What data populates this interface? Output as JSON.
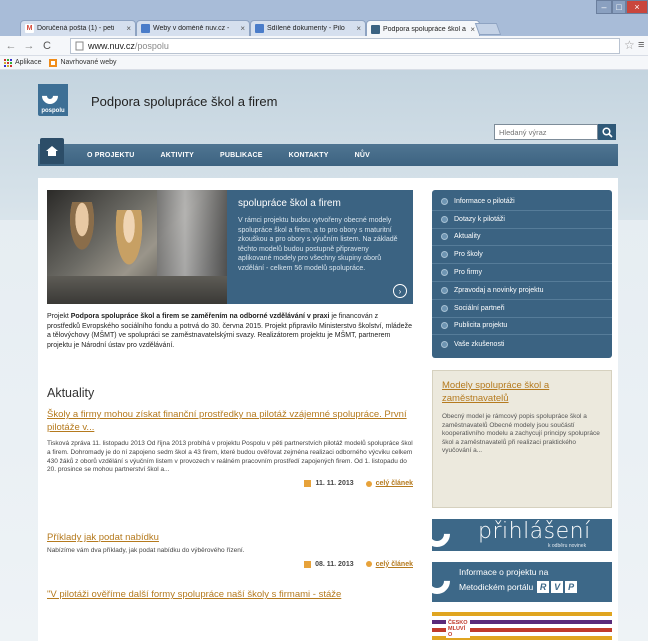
{
  "browser": {
    "tabs": [
      {
        "label": "Doručená pošta (1) - peti",
        "color": "#d44638",
        "glyph": "M"
      },
      {
        "label": "Weby v doméně nuv.cz -",
        "color": "#4a7cc9",
        "glyph": ""
      },
      {
        "label": "Sdílené dokumenty - Pilo",
        "color": "#4a7cc9",
        "glyph": ""
      },
      {
        "label": "Podpora spolupráce škol a",
        "color": "#3b6382",
        "glyph": ""
      }
    ],
    "tab_close": "×",
    "url_host": "www.nuv.cz",
    "url_path": "/pospolu",
    "bookmarks": [
      {
        "label": "Aplikace",
        "icon": "apps-icon"
      },
      {
        "label": "Navrhované weby",
        "icon": "suggested-sites-icon"
      }
    ]
  },
  "site": {
    "logo_text": "pospolu",
    "title": "Podpora spolupráce škol a firem",
    "search_placeholder": "Hledaný výraz",
    "nav": [
      "O PROJEKTU",
      "AKTIVITY",
      "PUBLIKACE",
      "KONTAKTY",
      "NŮV"
    ]
  },
  "feature": {
    "title": "spolupráce škol a firem",
    "text": "V rámci projektu budou vytvořeny obecné modely spolupráce škol a firem, a to pro obory s maturitní zkouškou a pro obory s výučním listem. Na základě těchto modelů budou postupně připraveny aplikované modely pro všechny skupiny oborů vzdělání - celkem 56 modelů spolupráce."
  },
  "intro": {
    "prefix": "Projekt ",
    "bold": "Podpora spolupráce škol a firem se zaměřením na odborné vzdělávání v praxi",
    "suffix": " je financován z prostředků Evropského sociálního fondu a potrvá do 30. června 2015. Projekt připravilo Ministerstvo školství, mládeže a tělovýchovy (MŠMT) ve spolupráci se zaměstnavatelskými svazy. Realizátorem projektu je MŠMT, partnerem projektu je Národní ústav pro vzdělávání."
  },
  "news": {
    "heading": "Aktuality",
    "more_label": "celý článek",
    "items": [
      {
        "title": "Školy a firmy mohou získat finanční prostředky na pilotáž vzájemné spolupráce. První pilotáže v...",
        "text": "Tisková zpráva 11. listopadu 2013 Od října 2013 probíhá v projektu Pospolu v pěti partnerstvích pilotáž modelů spolupráce škol a firem. Dohromady je do ní zapojeno sedm škol a 43 firem, které budou ověřovat zejména realizaci odborného výcviku celkem 430 žáků z oborů vzdělání s výučním listem v provozech v reálném pracovním prostředí zapojených firem. Od 1. listopadu do 20. prosince se mohou partnerství škol a...",
        "date": "11. 11. 2013"
      },
      {
        "title": "Příklady jak podat nabídku",
        "text": "Nabízíme vám dva příklady, jak podat nabídku do výběrového řízení.",
        "date": "08. 11. 2013"
      },
      {
        "title": "\"V pilotáži ověříme další formy spolupráce naší školy s firmami - stáže",
        "text": "",
        "date": ""
      }
    ]
  },
  "sidebar": {
    "menu": [
      "Informace o pilotáži",
      "Dotazy k pilotáži",
      "Aktuality",
      "Pro školy",
      "Pro firmy",
      "Zpravodaj a novinky projektu",
      "Sociální partneři",
      "Publicita projektu",
      "Vaše zkušenosti"
    ],
    "models_title": "Modely spolupráce škol a zaměstnavatelů",
    "models_text": "Obecný model je rámcový popis spolupráce škol a zaměstnavatelů Obecné modely jsou součástí kooperativního modelu a zachycují principy spolupráce škol a zaměstnavatelů při realizaci praktického vyučování a...",
    "login_title": "přihlášení",
    "login_sub": "k odběru novinek",
    "rvp_line1": "Informace o projektu na",
    "rvp_line2": "Metodickém portálu",
    "rvp_letters": [
      "R",
      "V",
      "P"
    ],
    "cesko_lines": [
      "ČESKO",
      "MLUVÍ",
      "O"
    ]
  },
  "colors": {
    "nav_blue": "#3d6381",
    "accent_orange": "#b57a1e",
    "panel_blue": "#3b6382"
  }
}
